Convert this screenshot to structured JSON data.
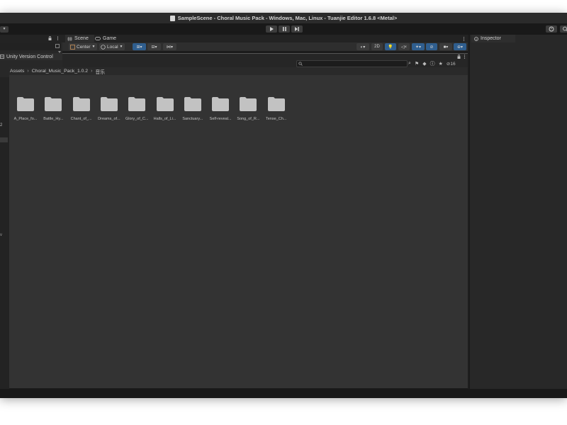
{
  "window": {
    "title": "SampleScene - Choral Music Pack - Windows, Mac, Linux - Tuanjie Editor 1.6.8 <Metal>"
  },
  "left_panel": {
    "version_control_label": "Unity Version Control",
    "row_number": "2"
  },
  "scene_view": {
    "tabs": [
      {
        "label": "Scene",
        "icon": "scene-hash-icon"
      },
      {
        "label": "Game",
        "icon": "game-controller-icon"
      }
    ],
    "pivot_dropdown": "Center",
    "space_dropdown": "Local",
    "mode_2d_label": "2D"
  },
  "project_browser": {
    "breadcrumb": [
      "Assets",
      "Choral_Music_Pack_1.0.2",
      "音乐"
    ],
    "visibility_count": "16",
    "folders": [
      "A_Place_fo...",
      "Battle_Hy...",
      "Chant_of_...",
      "Dreams_of...",
      "Glory_of_C...",
      "Halls_of_Li...",
      "Sanctuary...",
      "Self-reveal...",
      "Song_of_R...",
      "Tense_Ch..."
    ],
    "zoom_level": 0.6
  },
  "inspector": {
    "tab_label": "Inspector"
  },
  "colors": {
    "accent_blue": "#2f5e8e",
    "folder_gray": "#c2c2c2"
  }
}
